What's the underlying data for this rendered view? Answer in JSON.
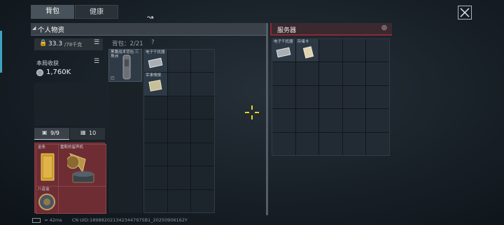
{
  "tabs": [
    {
      "label": "背包",
      "active": true
    },
    {
      "label": "健康",
      "active": false
    }
  ],
  "personal": {
    "title": "个人物资",
    "weight": "33.3",
    "weight_cap": "/78千克",
    "round_income_label": "本局收获",
    "round_income": "1,760K"
  },
  "backpack": {
    "label": "背包：2/21",
    "hint": "?",
    "item1": "黑鹰战术背包·三角洲",
    "items": [
      "电子干扰器",
      "军事情报"
    ]
  },
  "pouch": {
    "slots": "9/9",
    "count": "10",
    "items": [
      "金条",
      "雷斯的留声机",
      "八音盒"
    ]
  },
  "server": {
    "title": "服务器",
    "items": [
      "电子干扰器",
      "存储卡"
    ]
  },
  "status": {
    "ping": "42ms",
    "text": "CN UID:1898820213423447975B1_20250906162Y"
  },
  "colors": {
    "server_accent": "#8a2a35",
    "pouch_bg": "#6a2a30",
    "panel_header": "#3a4148"
  }
}
